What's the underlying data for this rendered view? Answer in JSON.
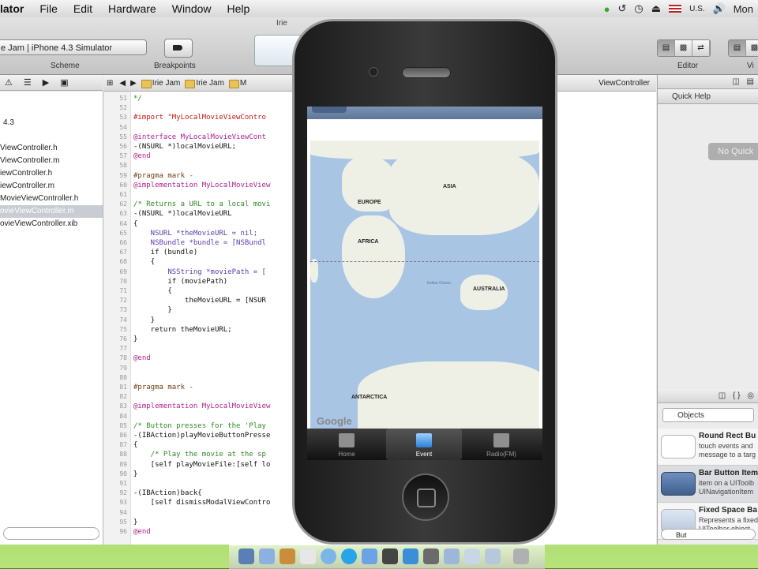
{
  "menubar": {
    "app": "lator",
    "items": [
      "File",
      "Edit",
      "Hardware",
      "Window",
      "Help"
    ],
    "locale": "U.S.",
    "clock": "Mon"
  },
  "toolbar": {
    "scheme_value": "e Jam | iPhone 4.3 Simulator",
    "scheme_label": "Scheme",
    "breakpoints_label": "Breakpoints",
    "editor_label": "Editor",
    "view_label": "Vi",
    "window_tab": "Irie"
  },
  "navigator": {
    "version": "4.3",
    "files": [
      "ViewController.h",
      "ViewController.m",
      "iewController.h",
      "iewController.m",
      "MovieViewController.h",
      "ovieViewController.m",
      "ovieViewController.xib"
    ],
    "selected_index": 5
  },
  "jumpbar": {
    "crumbs": [
      "Irie Jam",
      "Irie Jam",
      "M"
    ],
    "right_crumb": "ViewController"
  },
  "code_lines": [
    {
      "ln": "51",
      "t": "*/",
      "cls": "c-cm"
    },
    {
      "ln": "52",
      "t": "",
      "cls": ""
    },
    {
      "ln": "53",
      "t": "#import \"MyLocalMovieViewContro",
      "cls": "c-str"
    },
    {
      "ln": "54",
      "t": "",
      "cls": ""
    },
    {
      "ln": "55",
      "t": "@interface MyLocalMovieViewCont",
      "cls": "c-kw"
    },
    {
      "ln": "56",
      "t": "-(NSURL *)localMovieURL;",
      "cls": ""
    },
    {
      "ln": "57",
      "t": "@end",
      "cls": "c-kw"
    },
    {
      "ln": "58",
      "t": "",
      "cls": ""
    },
    {
      "ln": "59",
      "t": "#pragma mark -",
      "cls": "c-pp"
    },
    {
      "ln": "60",
      "t": "@implementation MyLocalMovieView",
      "cls": "c-kw"
    },
    {
      "ln": "61",
      "t": "",
      "cls": ""
    },
    {
      "ln": "62",
      "t": "/* Returns a URL to a local movi",
      "cls": "c-cm"
    },
    {
      "ln": "63",
      "t": "-(NSURL *)localMovieURL",
      "cls": ""
    },
    {
      "ln": "64",
      "t": "{",
      "cls": ""
    },
    {
      "ln": "65",
      "t": "    NSURL *theMovieURL = nil;",
      "cls": "c-ty"
    },
    {
      "ln": "66",
      "t": "    NSBundle *bundle = [NSBundl",
      "cls": "c-ty"
    },
    {
      "ln": "67",
      "t": "    if (bundle)",
      "cls": ""
    },
    {
      "ln": "68",
      "t": "    {",
      "cls": ""
    },
    {
      "ln": "69",
      "t": "        NSString *moviePath = [",
      "cls": "c-ty"
    },
    {
      "ln": "70",
      "t": "        if (moviePath)",
      "cls": ""
    },
    {
      "ln": "71",
      "t": "        {",
      "cls": ""
    },
    {
      "ln": "72",
      "t": "            theMovieURL = [NSUR",
      "cls": ""
    },
    {
      "ln": "73",
      "t": "        }",
      "cls": ""
    },
    {
      "ln": "74",
      "t": "    }",
      "cls": ""
    },
    {
      "ln": "75",
      "t": "    return theMovieURL;",
      "cls": ""
    },
    {
      "ln": "76",
      "t": "}",
      "cls": ""
    },
    {
      "ln": "77",
      "t": "",
      "cls": ""
    },
    {
      "ln": "78",
      "t": "@end",
      "cls": "c-kw"
    },
    {
      "ln": "79",
      "t": "",
      "cls": ""
    },
    {
      "ln": "80",
      "t": "",
      "cls": ""
    },
    {
      "ln": "81",
      "t": "#pragma mark -",
      "cls": "c-pp"
    },
    {
      "ln": "82",
      "t": "",
      "cls": ""
    },
    {
      "ln": "83",
      "t": "@implementation MyLocalMovieView",
      "cls": "c-kw"
    },
    {
      "ln": "84",
      "t": "",
      "cls": ""
    },
    {
      "ln": "85",
      "t": "/* Button presses for the 'Play",
      "cls": "c-cm"
    },
    {
      "ln": "86",
      "t": "-(IBAction)playMovieButtonPresse",
      "cls": ""
    },
    {
      "ln": "87",
      "t": "{",
      "cls": ""
    },
    {
      "ln": "88",
      "t": "    /* Play the movie at the sp",
      "cls": "c-cm"
    },
    {
      "ln": "89",
      "t": "    [self playMovieFile:[self lo",
      "cls": ""
    },
    {
      "ln": "90",
      "t": "}",
      "cls": ""
    },
    {
      "ln": "91",
      "t": "",
      "cls": ""
    },
    {
      "ln": "92",
      "t": "-(IBAction)back{",
      "cls": ""
    },
    {
      "ln": "93",
      "t": "    [self dismissModalViewContro",
      "cls": ""
    },
    {
      "ln": "94",
      "t": "",
      "cls": ""
    },
    {
      "ln": "95",
      "t": "}",
      "cls": ""
    },
    {
      "ln": "96",
      "t": "@end",
      "cls": "c-kw"
    }
  ],
  "utilities": {
    "quick_help_title": "Quick Help",
    "no_quick_help": "No Quick",
    "library_popup": "Objects",
    "filter_value": "But",
    "library_items": [
      {
        "title": "Round Rect Bu",
        "desc": "touch events and\nmessage to a targ"
      },
      {
        "title": "Bar Button Item",
        "desc": "item on a UIToolb\nUINavigationItem"
      },
      {
        "title": "Fixed Space Ba",
        "desc": "Represents a fixed\nUIToolbar object"
      }
    ]
  },
  "simulator": {
    "map_labels": {
      "europe": "EUROPE",
      "asia": "ASIA",
      "africa": "AFRICA",
      "australia": "AUSTRALIA",
      "antarctica": "ANTARCTICA",
      "ocean": "Indian Ocean"
    },
    "google": "Google",
    "tabs": [
      {
        "label": "Home",
        "icon": "home-icon"
      },
      {
        "label": "Event",
        "icon": "calendar-icon"
      },
      {
        "label": "Radio(FM)",
        "icon": "equalizer-icon"
      }
    ],
    "selected_tab": 1
  },
  "colors": {
    "ios_nav": "#5d7599",
    "ocean": "#a9c5e4",
    "land": "#eef0e6",
    "tab_selected": "#2d7fd5"
  }
}
